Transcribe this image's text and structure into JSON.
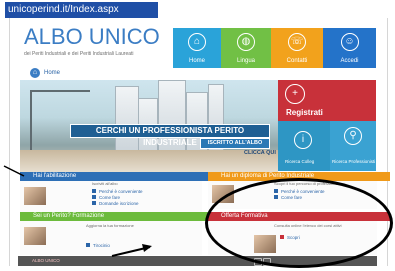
{
  "browser": {
    "url_text": "unicoperind.it/Index.aspx"
  },
  "header": {
    "title": "ALBO UNICO",
    "subtitle": "dei Periti Industriali e dei Periti Industriali Laureati"
  },
  "nav_tiles": [
    {
      "label": "Home",
      "icon": "home-icon",
      "color": "#2aa3d9"
    },
    {
      "label": "Lingua",
      "icon": "globe-icon",
      "color": "#71c045"
    },
    {
      "label": "Contatti",
      "icon": "phone-icon",
      "color": "#f2a21c"
    },
    {
      "label": "Accedi",
      "icon": "user-icon",
      "color": "#2473c9"
    }
  ],
  "breadcrumb": {
    "home_label": "Home",
    "icon": "home-icon"
  },
  "hero": {
    "cta_search": "CERCHI UN PROFESSIONISTA PERITO INDUSTRIALE",
    "cta_register": "ISCRITTO ALL'ALBO",
    "cta_click": "CLICCA QUI"
  },
  "side_tiles": {
    "register_label": "Registrati",
    "register_icon": "person-add-icon",
    "tile2_label": "Ricerca Colleg",
    "tile2_icon": "info-icon",
    "tile3_label": "Ricerca Professionisti",
    "tile3_icon": "search-icon",
    "colors": {
      "register": "#c8313a",
      "tile2": "#2e96c4",
      "tile3": "#3aa2d2"
    }
  },
  "panels": [
    {
      "title": "Hai l'abilitazione",
      "color": "#2d6fb6",
      "text": "Iscriviti all'albo",
      "links": [
        "Perché è conveniente",
        "Come fare",
        "Domande iscrizione"
      ]
    },
    {
      "title": "Hai un diploma di Perito Industriale",
      "color": "#f09a1a",
      "text": "Scopri il tuo percorso di professione",
      "links": [
        "Perché è conveniente",
        "Come fare"
      ]
    },
    {
      "title": "Sei un Perito? Formazione",
      "color": "#6cbb3c",
      "text": "Aggiorna la tua formazione",
      "links": [
        "Tirocinio"
      ]
    },
    {
      "title": "Offerta Formativa",
      "color": "#c8313a",
      "text": "Consulta online l'elenco dei corsi attivi",
      "links": [
        "Scopri"
      ]
    }
  ],
  "footer": {
    "text": "ALBO UNICO"
  }
}
